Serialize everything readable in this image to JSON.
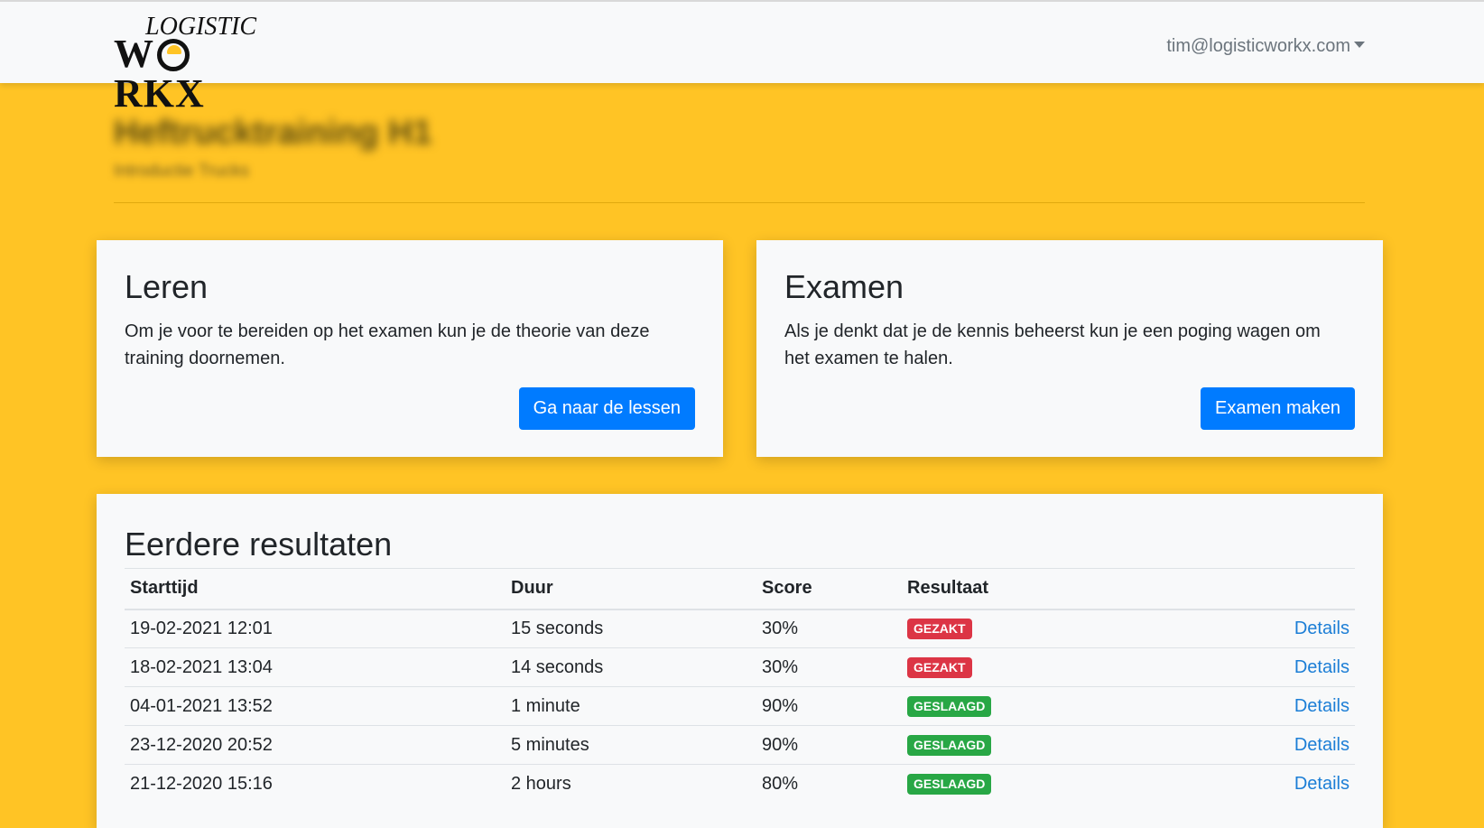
{
  "navbar": {
    "logo_top": "LOGISTIC",
    "logo_bottom_left": "W",
    "logo_bottom_right": "RKX",
    "user_email": "tim@logisticworkx.com"
  },
  "header": {
    "title": "Heftrucktraining H1",
    "subtitle": "Introductie Trucks"
  },
  "learn_card": {
    "title": "Leren",
    "text": "Om je voor te bereiden op het examen kun je de theorie van deze training doornemen.",
    "button": "Ga naar de lessen"
  },
  "exam_card": {
    "title": "Examen",
    "text": "Als je denkt dat je de kennis beheerst kun je een poging wagen om het examen te halen.",
    "button": "Examen maken"
  },
  "results": {
    "title": "Eerdere resultaten",
    "columns": {
      "start": "Starttijd",
      "duration": "Duur",
      "score": "Score",
      "result": "Resultaat"
    },
    "rows": [
      {
        "start": "19-02-2021 12:01",
        "duration": "15 seconds",
        "score": "30%",
        "result": "GEZAKT",
        "details": "Details"
      },
      {
        "start": "18-02-2021 13:04",
        "duration": "14 seconds",
        "score": "30%",
        "result": "GEZAKT",
        "details": "Details"
      },
      {
        "start": "04-01-2021 13:52",
        "duration": "1 minute",
        "score": "90%",
        "result": "GESLAAGD",
        "details": "Details"
      },
      {
        "start": "23-12-2020 20:52",
        "duration": "5 minutes",
        "score": "90%",
        "result": "GESLAAGD",
        "details": "Details"
      },
      {
        "start": "21-12-2020 15:16",
        "duration": "2 hours",
        "score": "80%",
        "result": "GESLAAGD",
        "details": "Details"
      }
    ]
  },
  "colors": {
    "background": "#ffc425",
    "primary": "#007bff",
    "fail": "#dc3545",
    "pass": "#28a745",
    "link": "#1c7ed6"
  }
}
